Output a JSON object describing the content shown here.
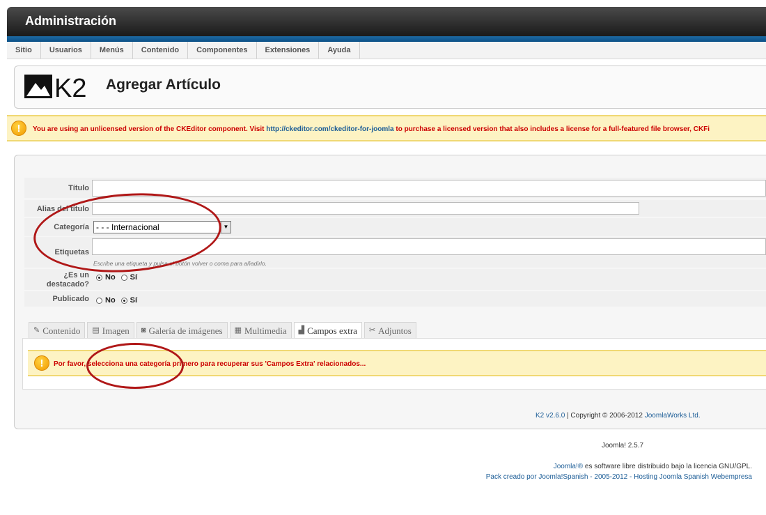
{
  "header": {
    "title": "Administración"
  },
  "menu": {
    "items": [
      "Sitio",
      "Usuarios",
      "Menús",
      "Contenido",
      "Componentes",
      "Extensiones",
      "Ayuda"
    ]
  },
  "toolbar": {
    "logo_text": "K2",
    "title": "Agregar Artículo"
  },
  "notice": {
    "text_before": "You are using an unlicensed version of the CKEditor component. Visit ",
    "link": "http://ckeditor.com/ckeditor-for-joomla",
    "text_after": " to purchase a licensed version that also includes a license for a full-featured file browser, CKFi"
  },
  "form": {
    "title_label": "Título",
    "title_value": "",
    "alias_label": "Alias del título",
    "alias_value": "",
    "category_label": "Categoría",
    "category_value": "- - - Internacional",
    "tags_label": "Etiquetas",
    "tags_hint": "Escribe una etiqueta y pulsa el botón volver o coma para añadirlo.",
    "featured_label_1": "¿Es un",
    "featured_label_2": "destacado?",
    "featured_no": "No",
    "featured_yes": "Sí",
    "featured_selected": "No",
    "published_label": "Publicado",
    "published_no": "No",
    "published_yes": "Sí",
    "published_selected": "Sí"
  },
  "tabs": [
    {
      "label": "Contenido",
      "icon": "edit-icon"
    },
    {
      "label": "Imagen",
      "icon": "image-icon"
    },
    {
      "label": "Galería de imágenes",
      "icon": "camera-icon"
    },
    {
      "label": "Multimedia",
      "icon": "film-icon"
    },
    {
      "label": "Campos extra",
      "icon": "fields-icon",
      "active": true
    },
    {
      "label": "Adjuntos",
      "icon": "paperclip-icon"
    }
  ],
  "panel_notice": "Por favor, selecciona una categoría primero para recuperar sus 'Campos Extra' relacionados...",
  "footer_k2": {
    "link1": "K2 v2.6.0",
    "middle": " | Copyright © 2006-2012 ",
    "link2": "JoomlaWorks Ltd."
  },
  "version": "Joomla! 2.5.7",
  "footer": {
    "line1_link": "Joomla!®",
    "line1_text": " es software libre distribuido bajo la licencia GNU/GPL.",
    "line2": "Pack creado por Joomla!Spanish - 2005-2012 - Hosting Joomla Spanish Webempresa"
  },
  "colors": {
    "header_blue": "#0b4f86",
    "warning_red": "#cc0000",
    "notice_bg": "#fdf3c3",
    "annotation_red": "#b01818"
  }
}
